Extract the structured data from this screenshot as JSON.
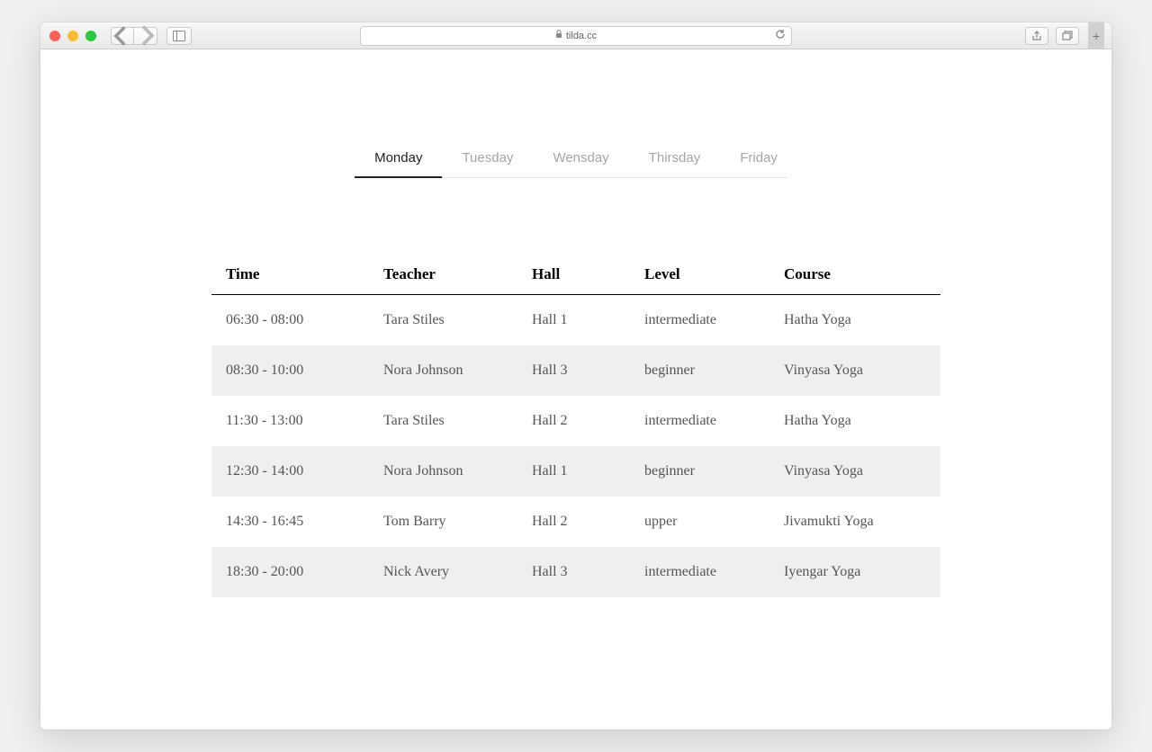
{
  "browser": {
    "url_display": "tilda.cc"
  },
  "tabs": [
    {
      "label": "Monday",
      "active": true
    },
    {
      "label": "Tuesday",
      "active": false
    },
    {
      "label": "Wensday",
      "active": false
    },
    {
      "label": "Thirsday",
      "active": false
    },
    {
      "label": "Friday",
      "active": false
    }
  ],
  "schedule": {
    "columns": [
      "Time",
      "Teacher",
      "Hall",
      "Level",
      "Course"
    ],
    "rows": [
      {
        "time": "06:30 - 08:00",
        "teacher": "Tara Stiles",
        "hall": "Hall 1",
        "level": "intermediate",
        "course": "Hatha Yoga"
      },
      {
        "time": "08:30 - 10:00",
        "teacher": "Nora Johnson",
        "hall": "Hall 3",
        "level": "beginner",
        "course": "Vinyasa Yoga"
      },
      {
        "time": "11:30 - 13:00",
        "teacher": "Tara Stiles",
        "hall": "Hall 2",
        "level": "intermediate",
        "course": "Hatha Yoga"
      },
      {
        "time": "12:30 - 14:00",
        "teacher": "Nora Johnson",
        "hall": "Hall 1",
        "level": "beginner",
        "course": "Vinyasa Yoga"
      },
      {
        "time": "14:30 - 16:45",
        "teacher": "Tom Barry",
        "hall": "Hall 2",
        "level": "upper",
        "course": "Jivamukti Yoga"
      },
      {
        "time": "18:30 - 20:00",
        "teacher": "Nick Avery",
        "hall": "Hall 3",
        "level": "intermediate",
        "course": "Iyengar Yoga"
      }
    ]
  }
}
